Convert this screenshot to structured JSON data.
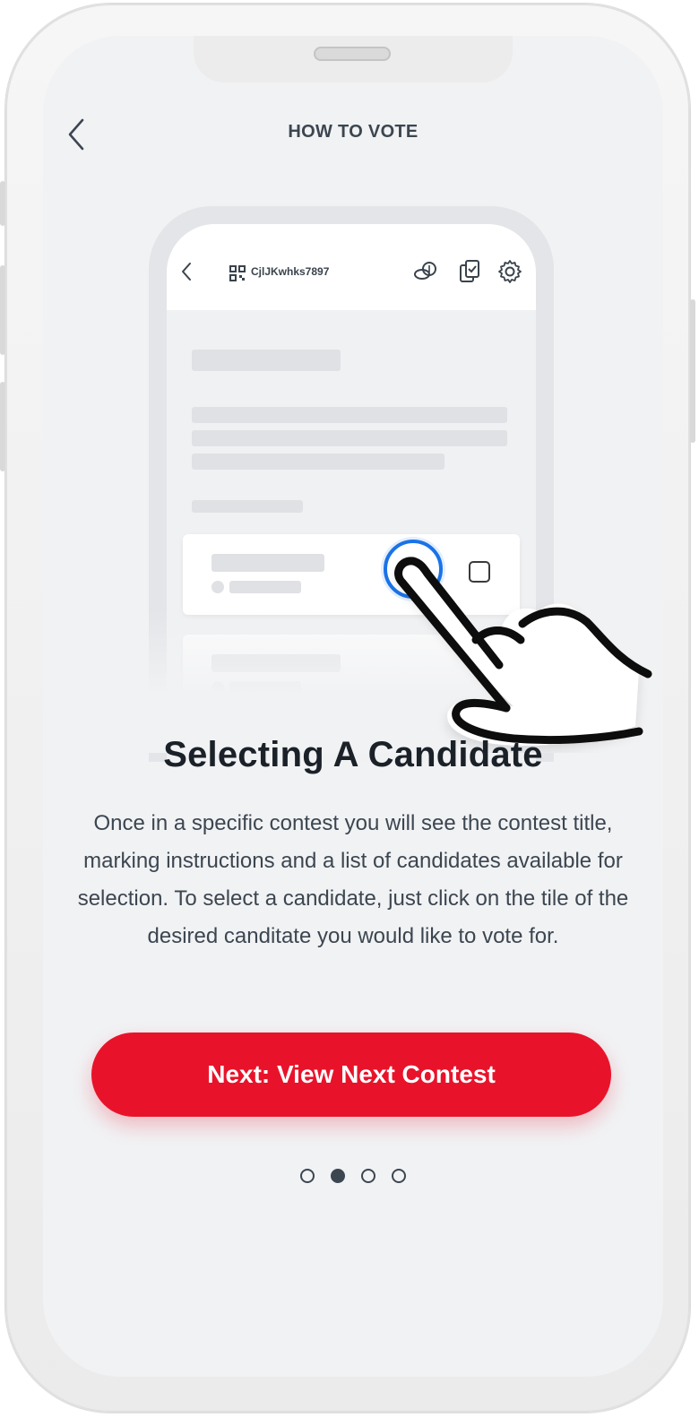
{
  "header": {
    "title": "HOW TO VOTE"
  },
  "illustration": {
    "code": "CjlJKwhks7897",
    "icons": [
      "qr-code-icon",
      "coins-icon",
      "ballot-icon",
      "gear-icon"
    ]
  },
  "content": {
    "title": "Selecting A Candidate",
    "body": "Once in a specific contest you will see the contest title, marking instructions and a list of candidates available for selection. To select a candidate, just click on the tile of the desired canditate you would like to vote for."
  },
  "actions": {
    "next_label": "Next: View Next Contest"
  },
  "pagination": {
    "total": 4,
    "active": 2
  },
  "colors": {
    "accent": "#e8132a",
    "ring": "#1a73e8",
    "text_dark": "#1b2128",
    "text": "#3c4650",
    "background": "#f1f2f4"
  }
}
